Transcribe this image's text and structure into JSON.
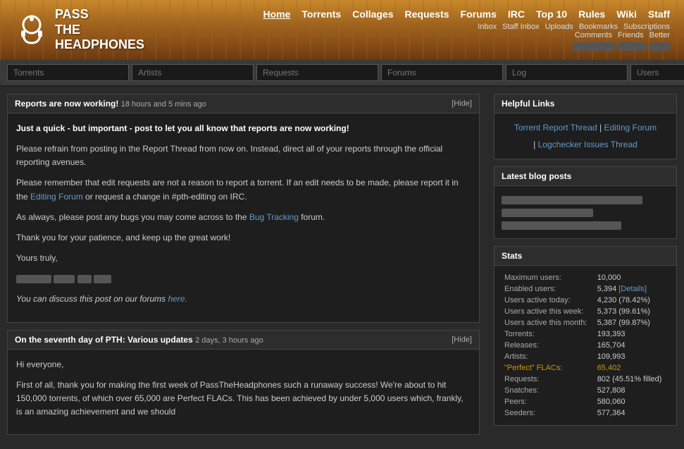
{
  "header": {
    "logo_line1": "PASS",
    "logo_line2": "THE",
    "logo_line3": "HEADPHONES",
    "nav": [
      {
        "label": "Home",
        "active": true
      },
      {
        "label": "Torrents",
        "active": false
      },
      {
        "label": "Collages",
        "active": false
      },
      {
        "label": "Requests",
        "active": false
      },
      {
        "label": "Forums",
        "active": false
      },
      {
        "label": "IRC",
        "active": false
      },
      {
        "label": "Top 10",
        "active": false
      },
      {
        "label": "Rules",
        "active": false
      },
      {
        "label": "Wiki",
        "active": false
      },
      {
        "label": "Staff",
        "active": false
      }
    ],
    "user_nav": [
      "Inbox",
      "Staff Inbox",
      "Uploads",
      "Bookmarks",
      "Subscriptions"
    ],
    "user_nav2": [
      "Comments",
      "Friends",
      "Better"
    ]
  },
  "search_bar": {
    "inputs": [
      {
        "placeholder": "Torrents"
      },
      {
        "placeholder": "Artists"
      },
      {
        "placeholder": "Requests"
      },
      {
        "placeholder": "Forums"
      },
      {
        "placeholder": "Log"
      },
      {
        "placeholder": "Users"
      }
    ]
  },
  "announcements": [
    {
      "id": "ann1",
      "title": "Reports are now working!",
      "time": "18 hours and 5 mins ago",
      "hide_label": "[Hide]",
      "paragraphs": [
        {
          "type": "bold",
          "text": "Just a quick - but important - post to let you all know that reports are now working!"
        },
        {
          "type": "normal",
          "text": "Please refrain from posting in the Report Thread from now on. Instead, direct all of your reports through the official reporting avenues."
        },
        {
          "type": "normal",
          "text": "Please remember that edit requests are not a reason to report a torrent. If an edit needs to be made, please report it in the "
        },
        {
          "type": "normal",
          "text": " or request a change in #pth-editing on IRC."
        },
        {
          "type": "normal",
          "text": "As always, please post any bugs you may come across to the "
        },
        {
          "type": "normal",
          "text": " forum."
        },
        {
          "type": "normal",
          "text": "Thank you for your patience, and keep up the great work!"
        },
        {
          "type": "normal",
          "text": "Yours truly,"
        },
        {
          "type": "italic_link",
          "text": "You can discuss this post on our forums here."
        }
      ],
      "editing_forum_label": "Editing Forum",
      "bug_tracking_label": "Bug Tracking"
    },
    {
      "id": "ann2",
      "title": "On the seventh day of PTH: Various updates",
      "time": "2 days, 3 hours ago",
      "hide_label": "[Hide]",
      "body_preview": "Hi everyone,\n\nFirst of all, thank you for making the first week of PassTheHeadphones such a runaway success! We're about to hit 150,000 torrents, of which over 65,000 are Perfect FLACs. This has been achieved by under 5,000 users which, frankly, is an amazing achievement and we should"
    }
  ],
  "right_panel": {
    "helpful_links": {
      "title": "Helpful Links",
      "torrent_report": "Torrent Report Thread",
      "editing_forum": "Editing Forum",
      "logchecker": "Logchecker Issues Thread"
    },
    "blog": {
      "title": "Latest blog posts"
    },
    "stats": {
      "title": "Stats",
      "rows": [
        {
          "label": "Maximum users:",
          "value": "10,000"
        },
        {
          "label": "Enabled users:",
          "value": "5,394",
          "link": "[Details]"
        },
        {
          "label": "Users active today:",
          "value": "4,230 (78.42%)"
        },
        {
          "label": "Users active this week:",
          "value": "5,373 (99.61%)"
        },
        {
          "label": "Users active this month:",
          "value": "5,387 (99.87%)"
        },
        {
          "label": "Torrents:",
          "value": "193,393"
        },
        {
          "label": "Releases:",
          "value": "165,704"
        },
        {
          "label": "Artists:",
          "value": "109,993"
        },
        {
          "label": "\"Perfect\" FLACs:",
          "value": "65,402",
          "special": "yellow"
        },
        {
          "label": "Requests:",
          "value": "802 (45.51% filled)"
        },
        {
          "label": "Snatches:",
          "value": "527,808"
        },
        {
          "label": "Peers:",
          "value": "580,060"
        },
        {
          "label": "Seeders:",
          "value": "577,364"
        }
      ]
    }
  }
}
